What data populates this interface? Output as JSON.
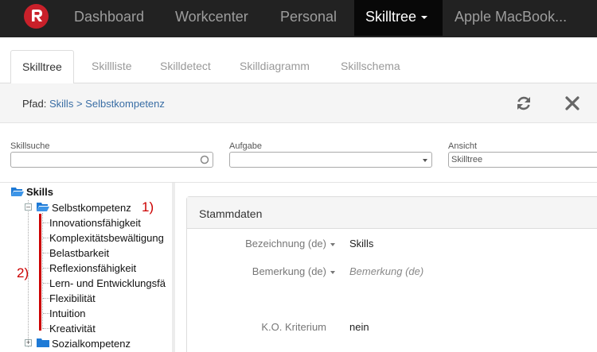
{
  "navbar": {
    "items": [
      {
        "label": "Dashboard"
      },
      {
        "label": "Workcenter"
      },
      {
        "label": "Personal"
      },
      {
        "label": "Skilltree"
      },
      {
        "label": "Apple MacBook..."
      }
    ],
    "active_index": 3
  },
  "tabs": [
    {
      "label": "Skilltree"
    },
    {
      "label": "Skillliste"
    },
    {
      "label": "Skilldetect"
    },
    {
      "label": "Skilldiagramm"
    },
    {
      "label": "Skillschema"
    }
  ],
  "path": {
    "label": "Pfad:",
    "links": [
      "Skills",
      "Selbstkompetenz"
    ],
    "separator": ">"
  },
  "filters": {
    "search_label": "Skillsuche",
    "search_value": "",
    "task_label": "Aufgabe",
    "task_value": "",
    "view_label": "Ansicht",
    "view_value": "Skilltree"
  },
  "tree": {
    "root": "Skills",
    "selbst": "Selbstkompetenz",
    "children": [
      "Innovationsfähigkeit",
      "Komplexitätsbewältigung",
      "Belastbarkeit",
      "Reflexionsfähigkeit",
      "Lern- und Entwicklungsfä",
      "Flexibilität",
      "Intuition",
      "Kreativität"
    ],
    "sozial": "Sozialkompetenz"
  },
  "annotations": {
    "one": "1)",
    "two": "2)"
  },
  "details": {
    "title": "Stammdaten",
    "name_label": "Bezeichnung (de)",
    "name_value": "Skills",
    "remark_label": "Bemerkung (de)",
    "remark_placeholder": "Bemerkung (de)",
    "ko_label": "K.O. Kriterium",
    "ko_value": "nein"
  },
  "colors": {
    "navbar_bg": "#222222",
    "brand_red": "#c9202a",
    "link": "#3a6ea5",
    "annotation_red": "#cc0000",
    "folder_blue": "#1e7ad6"
  },
  "icons": {
    "logo": "brand-logo-icon",
    "refresh": "refresh-icon",
    "close": "close-icon",
    "search": "search-icon",
    "folder": "folder-icon"
  }
}
